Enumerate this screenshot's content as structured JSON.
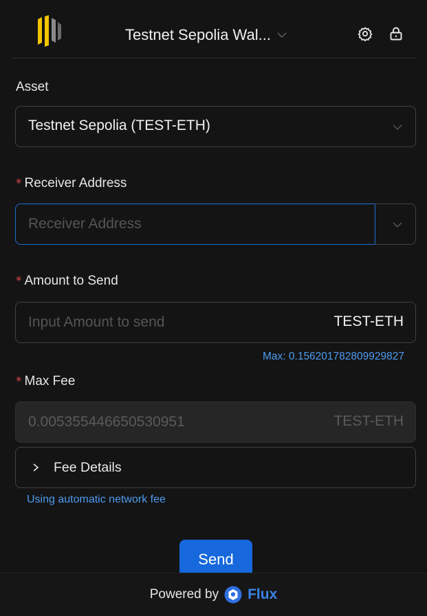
{
  "header": {
    "wallet_name": "Testnet Sepolia Wal...",
    "icons": [
      "logo-icon",
      "chevron-down-icon",
      "gear-icon",
      "lock-icon"
    ]
  },
  "asset": {
    "label": "Asset",
    "selected": "Testnet Sepolia (TEST-ETH)"
  },
  "receiver": {
    "required_mark": "*",
    "label": "Receiver Address",
    "placeholder": "Receiver Address",
    "value": ""
  },
  "amount": {
    "required_mark": "*",
    "label": "Amount to Send",
    "placeholder": "Input Amount to send",
    "suffix": "TEST-ETH",
    "max_text": "Max: 0.156201782809929827"
  },
  "fee": {
    "required_mark": "*",
    "label": "Max Fee",
    "value": "0.005355446650530951",
    "suffix": "TEST-ETH",
    "details_label": "Fee Details",
    "auto_note": "Using automatic network fee"
  },
  "actions": {
    "send_label": "Send"
  },
  "footer": {
    "powered_by": "Powered by",
    "brand": "Flux"
  },
  "colors": {
    "background": "#141414",
    "accent": "#1668dc",
    "link": "#4d9cf0",
    "required": "#dc4446"
  }
}
